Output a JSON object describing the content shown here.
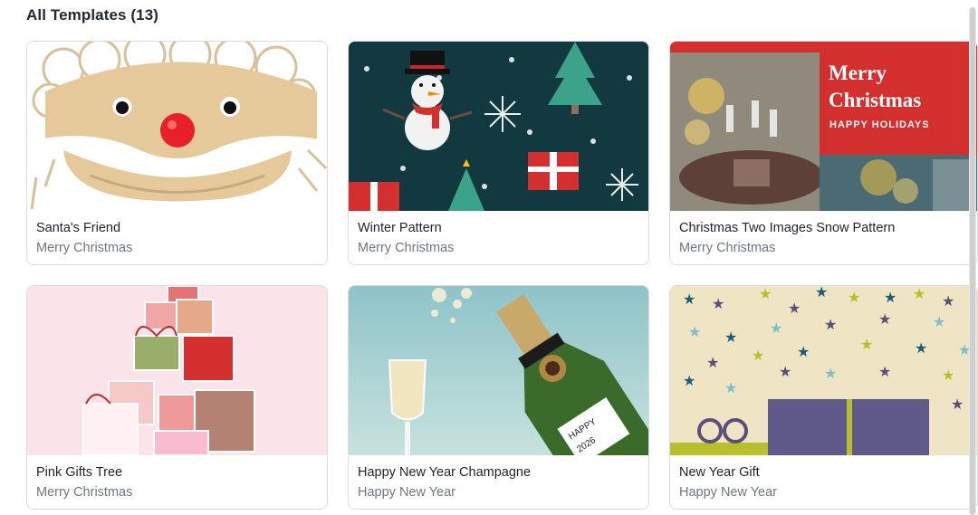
{
  "heading": "All Templates (13)",
  "templates": [
    {
      "name": "Santa's Friend",
      "category": "Merry Christmas",
      "thumb_icon": "santa-face-icon"
    },
    {
      "name": "Winter Pattern",
      "category": "Merry Christmas",
      "thumb_icon": "snowman-pattern-icon"
    },
    {
      "name": "Christmas Two Images Snow Pattern",
      "category": "Merry Christmas",
      "thumb_icon": "christmas-photo-icon",
      "thumb_text": {
        "line1": "Merry",
        "line2": "Christmas",
        "line3": "HAPPY HOLIDAYS"
      }
    },
    {
      "name": "Pink Gifts Tree",
      "category": "Merry Christmas",
      "thumb_icon": "gift-tree-icon"
    },
    {
      "name": "Happy New Year Champagne",
      "category": "Happy New Year",
      "thumb_icon": "champagne-icon",
      "thumb_text": {
        "label1": "HAPPY",
        "label2": "2026"
      }
    },
    {
      "name": "New Year Gift",
      "category": "Happy New Year",
      "thumb_icon": "stars-gift-icon"
    }
  ],
  "colors": {
    "christmas_red": "#d32f2f",
    "winter_bg": "#123840",
    "pink_bg": "#fbe3ea",
    "champagne_bg": "#a8d0d4",
    "gift_bg": "#efe4c4"
  }
}
